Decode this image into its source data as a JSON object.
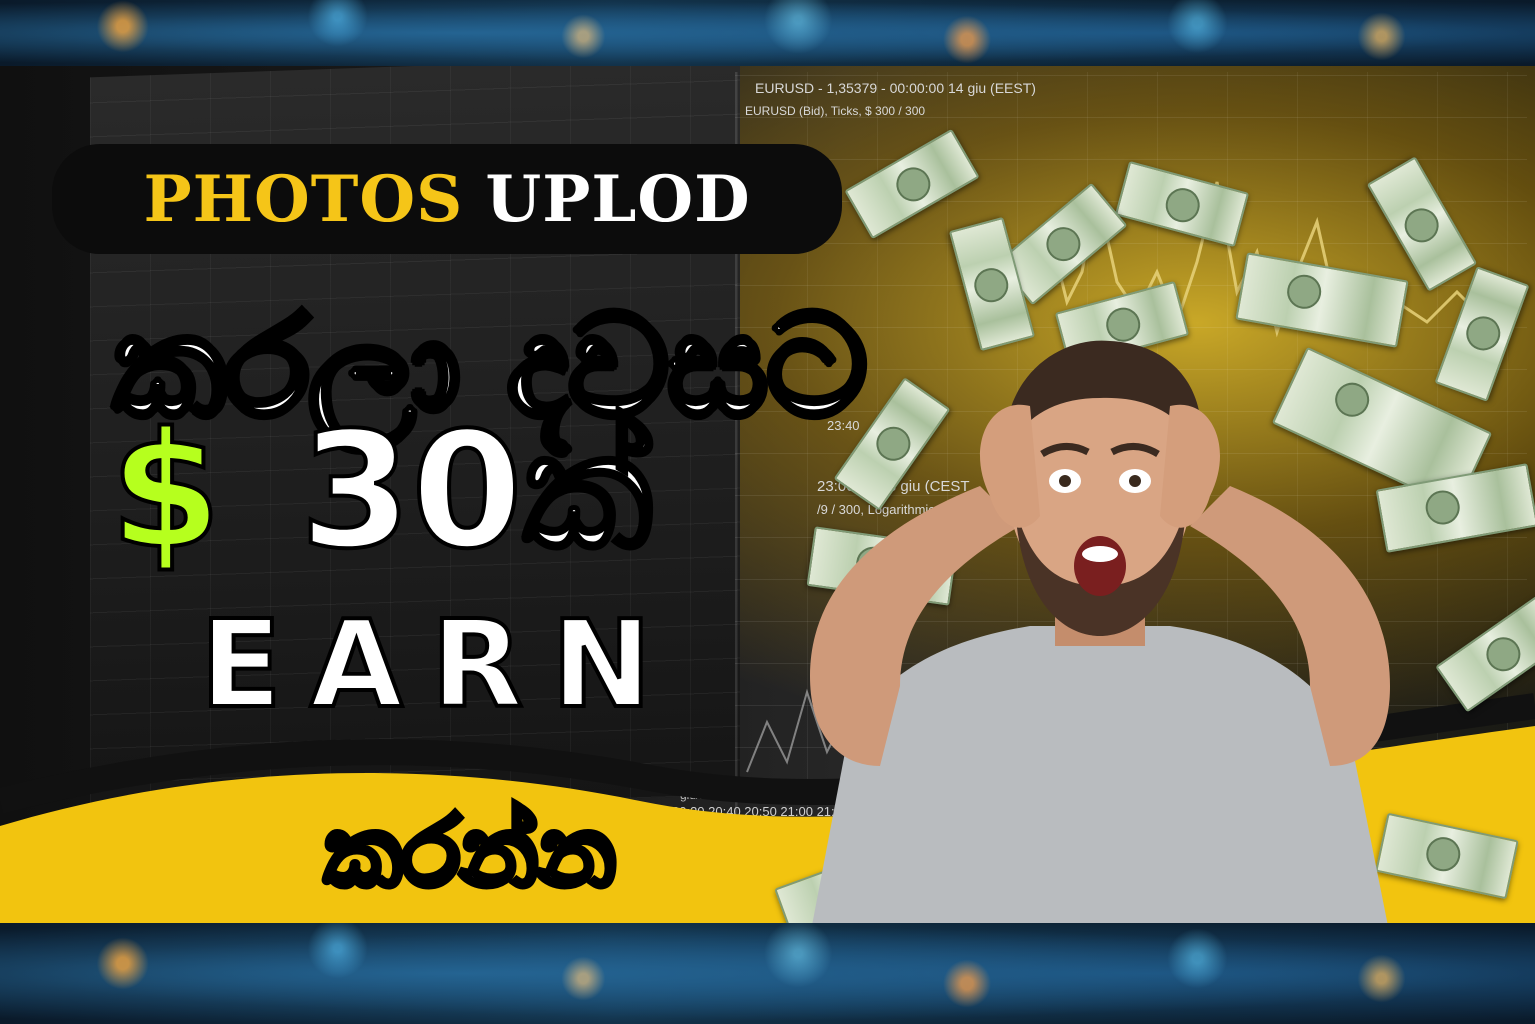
{
  "thumbnail": {
    "title_part1": "PHOTOS",
    "title_part2": "UPLOD",
    "sinhala_line1": "කරලා දවසට",
    "dollar_sign": "$",
    "amount": "30ක්",
    "earn": "EARN",
    "sinhala_line2": "කරන්න"
  },
  "chart_overlay": {
    "header": "EURUSD - 1,35379 - 00:00:00  14 giu (EEST)",
    "subheader": "EURUSD (Bid), Ticks, $ 300 / 300",
    "mid_time": "23:00:00  13 giu (CEST",
    "mid_sub": "/9 / 300, Logarithmic, Heiki",
    "side_value": "23:40",
    "axis_times": "20:30 20:40 20:50 21:00 21:10 21:20 21:30",
    "axis_date": "giu/13/14"
  },
  "colors": {
    "accent_yellow": "#f5c518",
    "accent_green": "#b6ff1e",
    "wave_yellow": "#f2c40f"
  }
}
